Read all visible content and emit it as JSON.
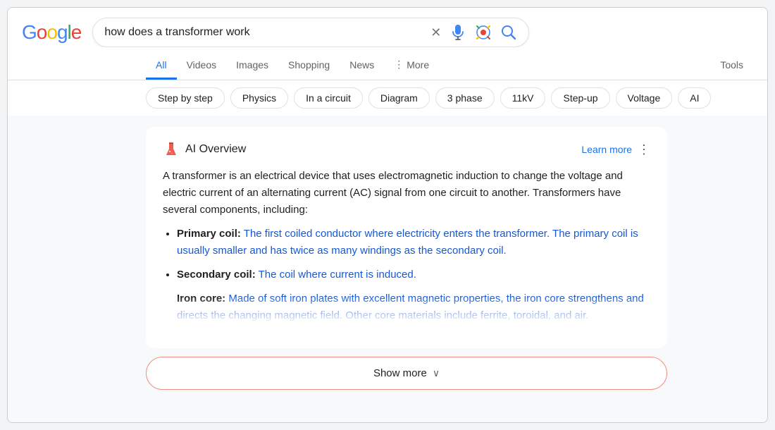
{
  "header": {
    "logo": "Google",
    "search_query": "how does a transformer work"
  },
  "nav": {
    "tabs": [
      {
        "id": "all",
        "label": "All",
        "active": true
      },
      {
        "id": "videos",
        "label": "Videos",
        "active": false
      },
      {
        "id": "images",
        "label": "Images",
        "active": false
      },
      {
        "id": "shopping",
        "label": "Shopping",
        "active": false
      },
      {
        "id": "news",
        "label": "News",
        "active": false
      },
      {
        "id": "more",
        "label": "More",
        "active": false,
        "has_icon": true
      }
    ],
    "tools_label": "Tools"
  },
  "chips": [
    "Step by step",
    "Physics",
    "In a circuit",
    "Diagram",
    "3 phase",
    "11kV",
    "Step-up",
    "Voltage",
    "AI"
  ],
  "ai_overview": {
    "title": "AI Overview",
    "learn_more": "Learn more",
    "intro": "A transformer is an electrical device that uses electromagnetic induction to change the voltage and electric current of an alternating current (AC) signal from one circuit to another. Transformers have several components, including:",
    "items": [
      {
        "term": "Primary coil:",
        "definition": "The first coiled conductor where electricity enters the transformer. The primary coil is usually smaller and has twice as many windings as the secondary coil."
      },
      {
        "term": "Secondary coil:",
        "definition": "The coil where current is induced."
      },
      {
        "term": "Iron core:",
        "definition": "Made of soft iron plates with excellent magnetic properties, the iron core strengthens and directs the changing magnetic field. Other core materials include ferrite, toroidal, and air."
      }
    ],
    "show_more_label": "Show more"
  }
}
